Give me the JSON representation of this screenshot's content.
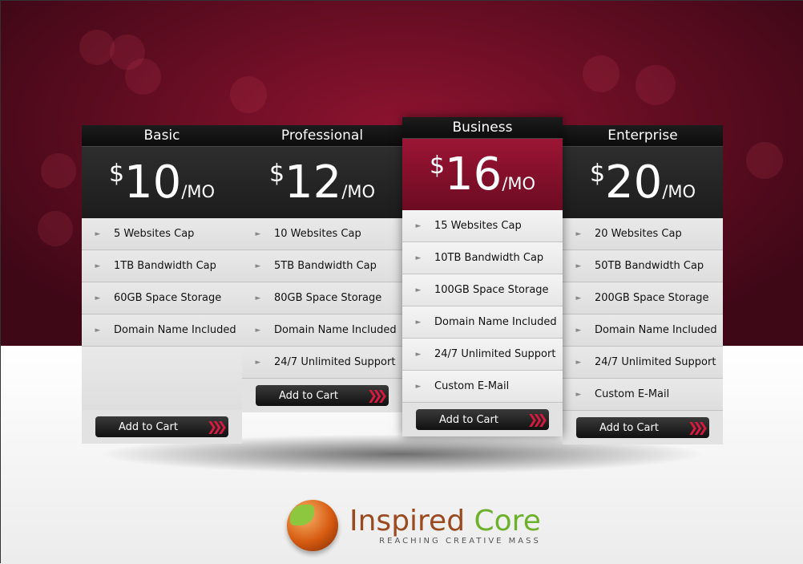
{
  "plans": [
    {
      "name": "Basic",
      "currency": "$",
      "amount": "10",
      "period": "/MO",
      "features": [
        "5 Websites Cap",
        "1TB Bandwidth Cap",
        "60GB Space Storage",
        "Domain Name Included"
      ],
      "button": "Add to Cart"
    },
    {
      "name": "Professional",
      "currency": "$",
      "amount": "12",
      "period": "/MO",
      "features": [
        "10 Websites Cap",
        "5TB Bandwidth Cap",
        "80GB Space Storage",
        "Domain Name Included",
        "24/7 Unlimited Support"
      ],
      "button": "Add to Cart"
    },
    {
      "name": "Business",
      "currency": "$",
      "amount": "16",
      "period": "/MO",
      "featured": true,
      "features": [
        "15 Websites Cap",
        "10TB Bandwidth Cap",
        "100GB Space Storage",
        "Domain Name Included",
        "24/7 Unlimited Support",
        "Custom E-Mail"
      ],
      "button": "Add to Cart"
    },
    {
      "name": "Enterprise",
      "currency": "$",
      "amount": "20",
      "period": "/MO",
      "features": [
        "20 Websites Cap",
        "50TB Bandwidth Cap",
        "200GB Space Storage",
        "Domain Name Included",
        "24/7 Unlimited Support",
        "Custom E-Mail"
      ],
      "button": "Add to Cart"
    }
  ],
  "logo": {
    "word1": "Inspired",
    "word2": "Core",
    "tagline": "REACHING CREATIVE MASS"
  },
  "colors": {
    "accent": "#8e1330",
    "button_chevron": "#d41a40",
    "logo_green": "#6cb12b",
    "logo_brown": "#9a4a1e"
  }
}
